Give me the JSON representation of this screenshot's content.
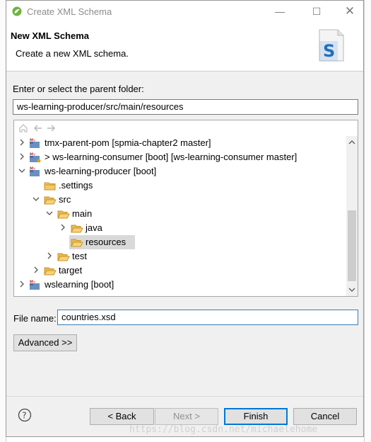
{
  "window": {
    "title": "Create XML Schema",
    "controls": {
      "minimize": "—",
      "maximize": "☐",
      "close": "✕"
    }
  },
  "banner": {
    "heading": "New XML Schema",
    "description": "Create a new XML schema."
  },
  "parent_folder": {
    "label": "Enter or select the parent folder:",
    "value": "ws-learning-producer/src/main/resources"
  },
  "tree": {
    "items": [
      {
        "label": "tmx-parent-pom [spmia-chapter2 master]",
        "expanded": false,
        "type": "maven-project"
      },
      {
        "label": "> ws-learning-consumer [boot] [ws-learning-consumer master]",
        "expanded": false,
        "type": "maven-project"
      },
      {
        "label": "ws-learning-producer [boot]",
        "expanded": true,
        "type": "maven-project"
      },
      {
        "label": ".settings",
        "type": "folder"
      },
      {
        "label": "src",
        "expanded": true,
        "type": "folder"
      },
      {
        "label": "main",
        "expanded": true,
        "type": "folder"
      },
      {
        "label": "java",
        "expanded": false,
        "type": "folder"
      },
      {
        "label": "resources",
        "selected": true,
        "type": "folder-open"
      },
      {
        "label": "test",
        "expanded": false,
        "type": "folder"
      },
      {
        "label": "target",
        "expanded": false,
        "type": "folder"
      },
      {
        "label": "wslearning [boot]",
        "expanded": false,
        "type": "maven-project"
      }
    ]
  },
  "file_name": {
    "label": "File name:",
    "value": "countries.xsd"
  },
  "buttons": {
    "advanced": "Advanced >>",
    "back": "< Back",
    "next": "Next >",
    "finish": "Finish",
    "cancel": "Cancel"
  },
  "watermark": "https://blog.csdn.net/michaelehome",
  "colors": {
    "accent": "#0078d7",
    "selection": "#d9d9d9",
    "folder": "#e8b64a"
  }
}
